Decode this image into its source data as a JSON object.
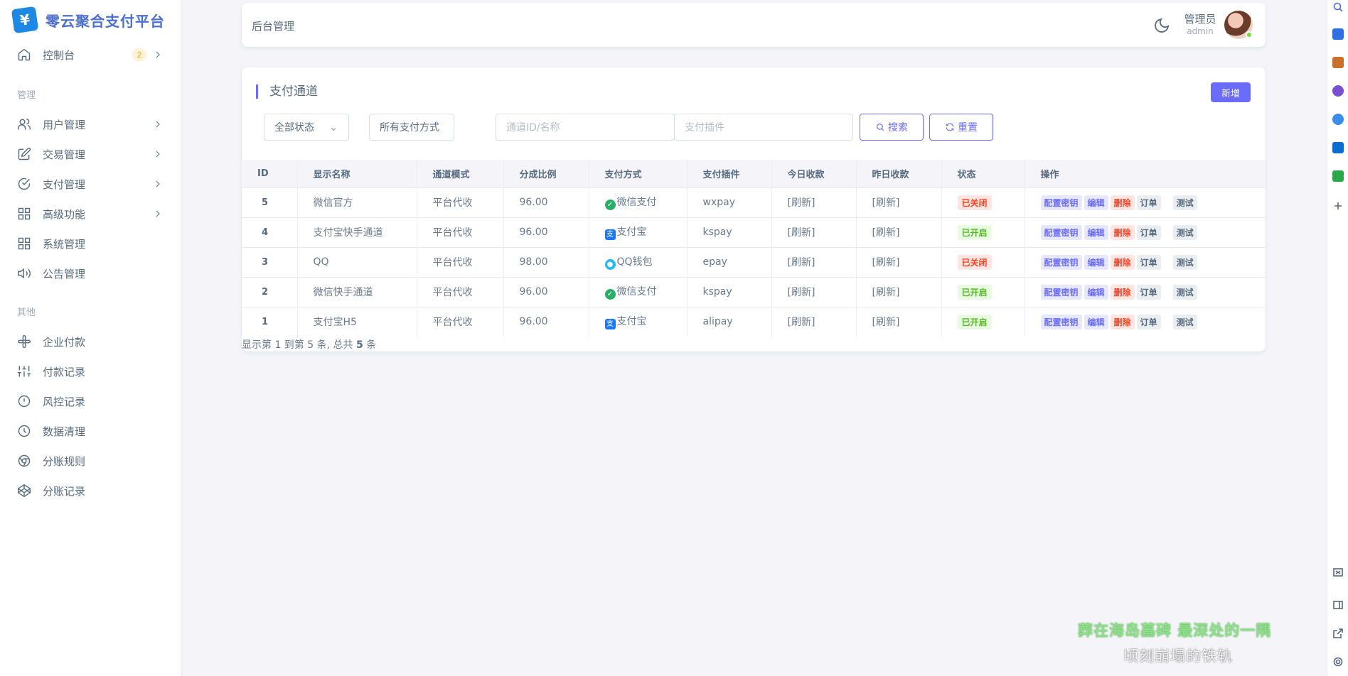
{
  "brand": {
    "logo_glyph": "¥",
    "name": "零云聚合支付平台"
  },
  "sidebar": {
    "dashboard": {
      "label": "控制台",
      "badge": "2"
    },
    "section_manage": "管理",
    "manage_items": [
      {
        "label": "用户管理",
        "icon": "users-icon"
      },
      {
        "label": "交易管理",
        "icon": "edit-icon"
      },
      {
        "label": "支付管理",
        "icon": "check-circle-icon"
      },
      {
        "label": "高级功能",
        "icon": "grid-icon"
      },
      {
        "label": "系统管理",
        "icon": "grid-icon"
      },
      {
        "label": "公告管理",
        "icon": "speaker-icon"
      }
    ],
    "section_other": "其他",
    "other_items": [
      {
        "label": "企业付款",
        "icon": "slack-icon"
      },
      {
        "label": "付款记录",
        "icon": "sliders-icon"
      },
      {
        "label": "风控记录",
        "icon": "alert-circle-icon"
      },
      {
        "label": "数据清理",
        "icon": "clock-icon"
      },
      {
        "label": "分账规则",
        "icon": "chrome-icon"
      },
      {
        "label": "分账记录",
        "icon": "codepen-icon"
      }
    ]
  },
  "navbar": {
    "title": "后台管理",
    "user_name": "管理员",
    "user_role": "admin"
  },
  "card": {
    "title": "支付通道",
    "add_button": "新增",
    "filters": {
      "status_select": "全部状态",
      "paytype_select": "所有支付方式",
      "channel_placeholder": "通道ID/名称",
      "plugin_placeholder": "支付插件",
      "search_button": "搜索",
      "reset_button": "重置"
    }
  },
  "table": {
    "headers": [
      "ID",
      "显示名称",
      "通道模式",
      "分成比例",
      "支付方式",
      "支付插件",
      "今日收款",
      "昨日收款",
      "状态",
      "操作"
    ],
    "rows": [
      {
        "id": "5",
        "name": "微信官方",
        "mode": "平台代收",
        "ratio": "96.00",
        "paytype": "微信支付",
        "paytype_icon": "wechat",
        "plugin": "wxpay",
        "today": "[刷新]",
        "yesterday": "[刷新]",
        "status": "已关闭",
        "status_kind": "closed"
      },
      {
        "id": "4",
        "name": "支付宝快手通道",
        "mode": "平台代收",
        "ratio": "96.00",
        "paytype": "支付宝",
        "paytype_icon": "alipay",
        "plugin": "kspay",
        "today": "[刷新]",
        "yesterday": "[刷新]",
        "status": "已开启",
        "status_kind": "open"
      },
      {
        "id": "3",
        "name": "QQ",
        "mode": "平台代收",
        "ratio": "98.00",
        "paytype": "QQ钱包",
        "paytype_icon": "qq",
        "plugin": "epay",
        "today": "[刷新]",
        "yesterday": "[刷新]",
        "status": "已关闭",
        "status_kind": "closed"
      },
      {
        "id": "2",
        "name": "微信快手通道",
        "mode": "平台代收",
        "ratio": "96.00",
        "paytype": "微信支付",
        "paytype_icon": "wechat",
        "plugin": "kspay",
        "today": "[刷新]",
        "yesterday": "[刷新]",
        "status": "已开启",
        "status_kind": "open"
      },
      {
        "id": "1",
        "name": "支付宝H5",
        "mode": "平台代收",
        "ratio": "96.00",
        "paytype": "支付宝",
        "paytype_icon": "alipay",
        "plugin": "alipay",
        "today": "[刷新]",
        "yesterday": "[刷新]",
        "status": "已开启",
        "status_kind": "open"
      }
    ],
    "actions": {
      "config": "配置密钥",
      "edit": "编辑",
      "delete": "删除",
      "orders": "订单",
      "test": "测试"
    }
  },
  "pagination": {
    "prefix": "显示第 1 到第 5 条, 总共 ",
    "total": "5",
    "suffix": " 条"
  },
  "subtitles": {
    "line1": "葬在海岛墓碑 最深处的一隅",
    "line2": "顷刻崩塌的铁轨"
  },
  "colors": {
    "primary": "#696cff",
    "danger": "#ff3e1d",
    "success": "#56b72a",
    "warning": "#ffab00"
  }
}
